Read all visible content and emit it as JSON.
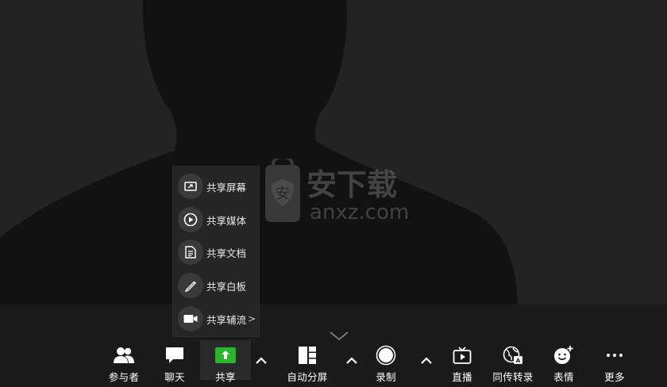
{
  "share_menu": {
    "items": [
      {
        "label": "共享屏幕",
        "icon": "share-screen-icon"
      },
      {
        "label": "共享媒体",
        "icon": "play-media-icon"
      },
      {
        "label": "共享文档",
        "icon": "document-icon"
      },
      {
        "label": "共享白板",
        "icon": "pen-whiteboard-icon"
      },
      {
        "label": "共享辅流",
        "icon": "camera-icon",
        "arrow": ">"
      }
    ]
  },
  "toolbar": {
    "participants": "参与者",
    "chat": "聊天",
    "share": "共享",
    "auto_split": "自动分屏",
    "record": "录制",
    "live": "直播",
    "simul_interp": "同传转录",
    "reactions": "表情",
    "more": "更多"
  },
  "colors": {
    "share_icon_green": "#2bb52b",
    "video_bg": "#232323",
    "silhouette": "#121212",
    "toolbar_bg": "#1a1a1a"
  },
  "watermark": {
    "logo_text": "安",
    "title": "安下载",
    "domain": "anxz.com"
  }
}
